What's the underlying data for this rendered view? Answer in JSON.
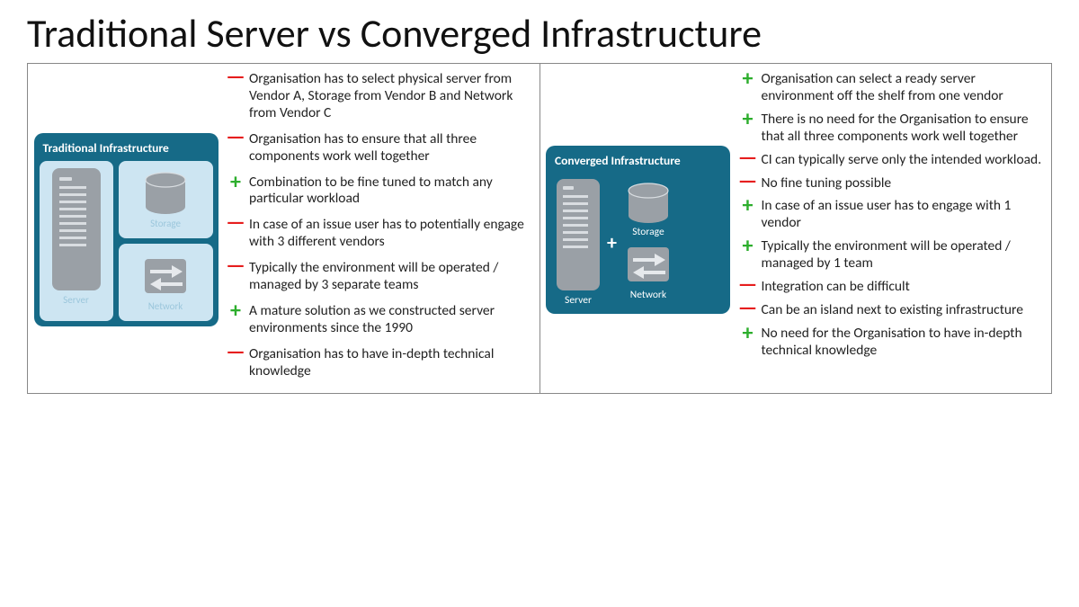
{
  "title": "Traditional Server vs Converged Infrastructure",
  "left": {
    "card_title": "Traditional  Infrastructure",
    "labels": {
      "server": "Server",
      "storage": "Storage",
      "network": "Network"
    },
    "points": [
      {
        "type": "minus",
        "text": "Organisation has to select physical server from Vendor A, Storage from Vendor B and Network from Vendor C"
      },
      {
        "type": "minus",
        "text": "Organisation has to ensure that all three components work well together"
      },
      {
        "type": "plus",
        "text": "Combination to be fine tuned to match any particular workload"
      },
      {
        "type": "minus",
        "text": "In case of an issue user has to potentially engage with 3 different vendors"
      },
      {
        "type": "minus",
        "text": "Typically the environment will be operated / managed by 3 separate teams"
      },
      {
        "type": "plus",
        "text": "A mature solution as we constructed server environments since the 1990"
      },
      {
        "type": "minus",
        "text": "Organisation has to have in-depth technical knowledge"
      }
    ]
  },
  "right": {
    "card_title": "Converged  Infrastructure",
    "labels": {
      "server": "Server",
      "storage": "Storage",
      "network": "Network"
    },
    "points": [
      {
        "type": "plus",
        "text": "Organisation can select a ready server environment off the shelf from one vendor"
      },
      {
        "type": "plus",
        "text": "There is no need for the Organisation to ensure that all three components work well together"
      },
      {
        "type": "minus",
        "text": "CI can typically serve only the intended workload."
      },
      {
        "type": "minus",
        "text": "No fine tuning possible"
      },
      {
        "type": "plus",
        "text": "In case of an issue user has to engage with 1 vendor"
      },
      {
        "type": "plus",
        "text": "Typically the environment will be operated / managed by 1 team"
      },
      {
        "type": "minus",
        "text": "Integration can be difficult"
      },
      {
        "type": "minus",
        "text": "Can be an island next to existing infrastructure"
      },
      {
        "type": "plus",
        "text": "No need for the Organisation to have in-depth technical knowledge"
      }
    ]
  }
}
